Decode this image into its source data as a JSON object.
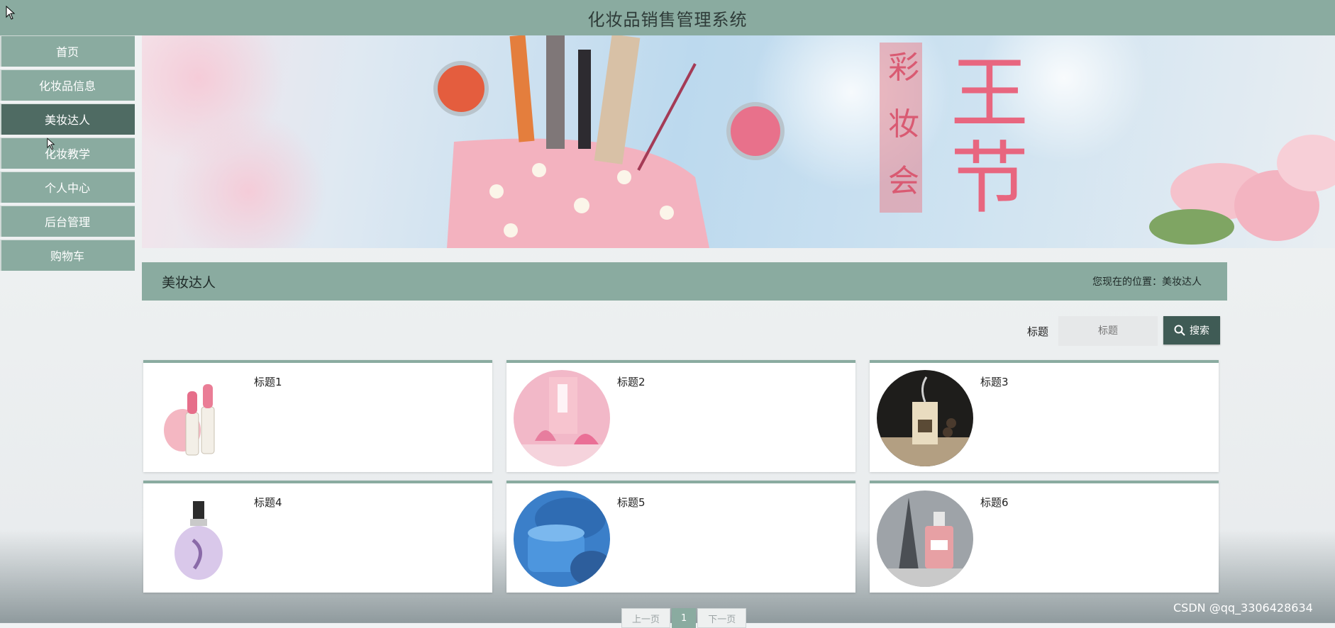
{
  "app": {
    "title": "化妆品销售管理系统"
  },
  "sidebar": {
    "items": [
      {
        "label": "首页",
        "active": false
      },
      {
        "label": "化妆品信息",
        "active": false
      },
      {
        "label": "美妆达人",
        "active": true
      },
      {
        "label": "化妆教学",
        "active": false
      },
      {
        "label": "个人中心",
        "active": false
      },
      {
        "label": "后台管理",
        "active": false
      },
      {
        "label": "购物车",
        "active": false
      }
    ]
  },
  "section": {
    "title": "美妆达人",
    "location_label": "您现在的位置：",
    "location_value": "美妆达人"
  },
  "search": {
    "label": "标题",
    "placeholder": "标题",
    "button_label": "搜索",
    "button_icon": "search-icon"
  },
  "cards": [
    {
      "title": "标题1",
      "image": "lipstick"
    },
    {
      "title": "标题2",
      "image": "pink-room"
    },
    {
      "title": "标题3",
      "image": "diffuser"
    },
    {
      "title": "标题4",
      "image": "perfume-bottle"
    },
    {
      "title": "标题5",
      "image": "blue-cream-jar"
    },
    {
      "title": "标题6",
      "image": "eiffel-perfume"
    }
  ],
  "pagination": {
    "prev": "上一页",
    "current": "1",
    "next": "下一页"
  },
  "watermark": "CSDN @qq_3306428634",
  "colors": {
    "accent": "#8aaba0",
    "active": "#4f6b63",
    "button": "#3f5b55"
  }
}
